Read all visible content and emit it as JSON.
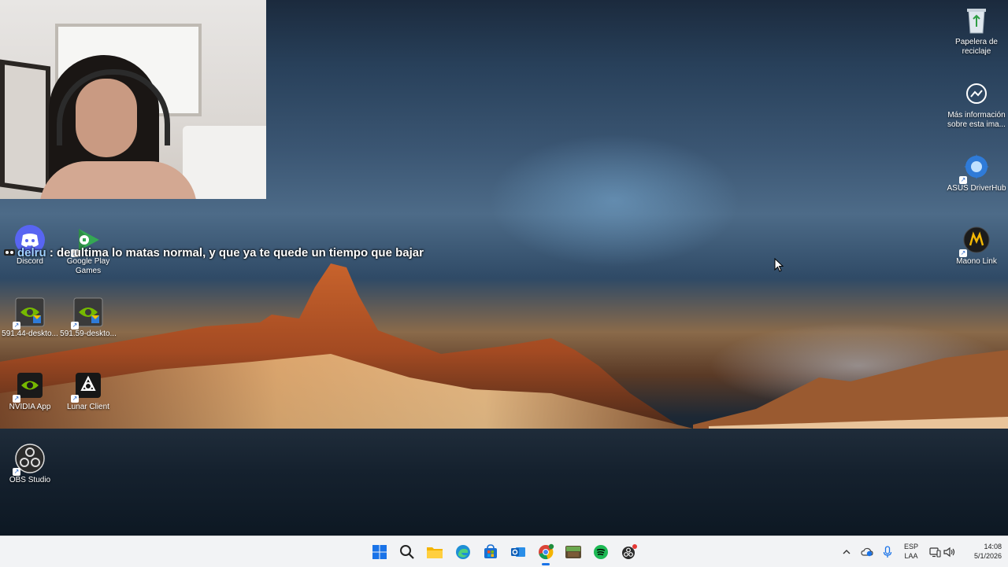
{
  "desktop": {
    "icons_left": [
      {
        "label": "Discord",
        "icon": "discord-icon"
      },
      {
        "label": "Google Play Games",
        "icon": "google-play-games-icon"
      },
      {
        "label": "591.44-deskto...",
        "icon": "nvidia-installer-icon"
      },
      {
        "label": "591.59-deskto...",
        "icon": "nvidia-installer-icon"
      },
      {
        "label": "NVIDIA App",
        "icon": "nvidia-app-icon"
      },
      {
        "label": "Lunar Client",
        "icon": "lunar-client-icon"
      },
      {
        "label": "OBS Studio",
        "icon": "obs-studio-icon"
      }
    ],
    "icons_right": [
      {
        "label": "Papelera de reciclaje",
        "icon": "recycle-bin-icon"
      },
      {
        "label": "Más información sobre esta ima...",
        "icon": "info-camera-icon"
      },
      {
        "label": "ASUS DriverHub",
        "icon": "asus-driverhub-icon"
      },
      {
        "label": "Maono Link",
        "icon": "maono-link-icon"
      }
    ]
  },
  "chat_overlay": {
    "username": "delru",
    "message": " : de ultima lo matas normal, y que ya te quede un tiempo que bajar"
  },
  "taskbar": {
    "apps": [
      {
        "name": "start",
        "icon": "windows-start-icon"
      },
      {
        "name": "search",
        "icon": "search-icon"
      },
      {
        "name": "file-explorer",
        "icon": "folder-icon"
      },
      {
        "name": "edge",
        "icon": "edge-icon"
      },
      {
        "name": "store",
        "icon": "store-icon"
      },
      {
        "name": "outlook",
        "icon": "outlook-icon"
      },
      {
        "name": "chrome",
        "icon": "chrome-icon"
      },
      {
        "name": "minecraft",
        "icon": "minecraft-icon"
      },
      {
        "name": "spotify",
        "icon": "spotify-icon"
      },
      {
        "name": "obs",
        "icon": "obs-icon"
      }
    ],
    "language": {
      "line1": "ESP",
      "line2": "LAA"
    },
    "time": "14:08",
    "date": "5/1/2026"
  },
  "colors": {
    "taskbar_bg": "#f2f3f5",
    "accent": "#1a73e8",
    "chat_username": "#9fd1ff"
  }
}
